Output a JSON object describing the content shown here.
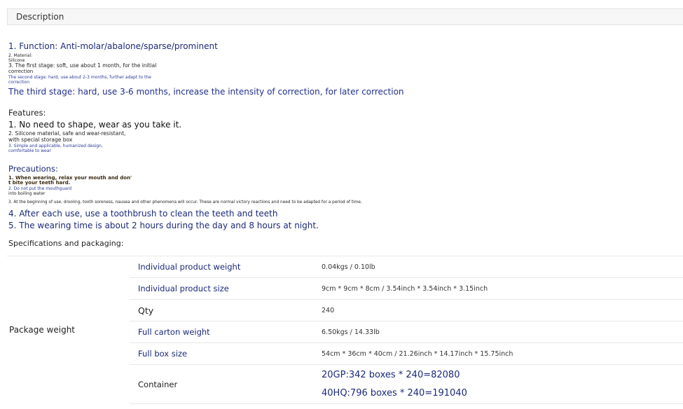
{
  "tab": {
    "label": "Description"
  },
  "function": {
    "line1": "1. Function: Anti-molar/abalone/sparse/prominent",
    "line2a": "2. Material:",
    "line2b": "Silicone",
    "line3a": "3. The first stage: soft, use about 1 month, for the initial",
    "line3b": "correction",
    "line4a": "The second stage: hard, use about 2-3 months, further adapt to the",
    "line4b": "correction",
    "line5": "The third stage: hard, use 3-6 months, increase the intensity of correction, for later correction"
  },
  "features": {
    "heading": "Features:",
    "item1": "1. No need to shape, wear as you take it.",
    "item2a": "2. Silicone material, safe and wear-resistant,",
    "item2b": "with special storage box",
    "item3a": "3. Simple and applicable, humanized design,",
    "item3b": "comfortable to wear"
  },
  "precautions": {
    "heading": "Precautions:",
    "item1a": "1. When wearing, relax your mouth and don'",
    "item1b": "t bite your teeth hard.",
    "item2a": "2. Do not put the mouthguard",
    "item2b": "into boiling water",
    "item3": "3. At the beginning of use, drooling, tooth soreness, nausea and other phenomena will occur. These are normal victory reactions and need to be adapted for a period of time.",
    "item4": "4. After each use, use a toothbrush to clean the teeth and teeth",
    "item5": "5. The wearing time is about 2 hours during the day and 8 hours at night."
  },
  "spec": {
    "heading": "Specifications and packaging:",
    "group": "Package weight",
    "rows": [
      {
        "label": "Individual product weight",
        "value": "0.04kgs / 0.10lb"
      },
      {
        "label": "Individual product size",
        "value": "9cm * 9cm * 8cm / 3.54inch * 3.54inch * 3.15inch"
      },
      {
        "label": "Qty",
        "value": "240"
      },
      {
        "label": "Full carton weight",
        "value": "6.50kgs / 14.33lb"
      },
      {
        "label": "Full box size",
        "value": "54cm * 36cm * 40cm / 21.26inch * 14.17inch * 15.75inch"
      }
    ],
    "container": {
      "label": "Container",
      "value1": "20GP:342 boxes * 240=82080",
      "value2": "40HQ:796 boxes * 240=191040"
    }
  }
}
